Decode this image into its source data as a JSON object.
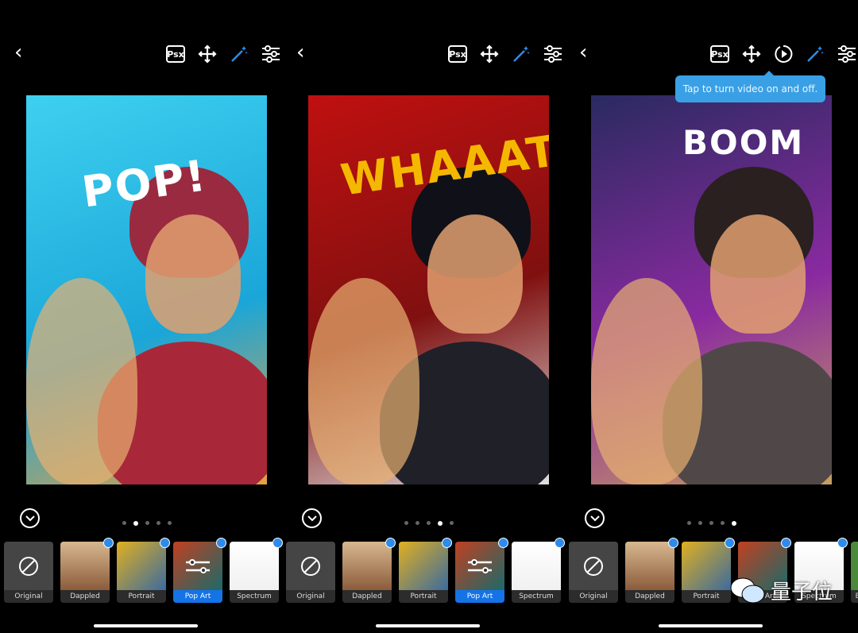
{
  "panels": [
    {
      "comic_text": "POP!",
      "bg": "linear-gradient(160deg,#3fd0f0,#1aa6d8 60%,#e8a040)",
      "shirt": "#a8283a",
      "hair": "#9a2a40",
      "active_dot": 1,
      "selected": "Pop Art",
      "comic_color": "#ffffff",
      "show_video": false
    },
    {
      "comic_text": "WHAAAT!",
      "bg": "linear-gradient(160deg,#c01010,#801010 55%,#e0e0e0)",
      "shirt": "#202028",
      "hair": "#101018",
      "active_dot": 3,
      "selected": "Pop Art",
      "comic_color": "#f5b800",
      "show_video": false
    },
    {
      "comic_text": "BOOM",
      "bg": "linear-gradient(160deg,#2a2a60,#8a2aa0 55%,#c8a060)",
      "shirt": "#504848",
      "hair": "#2a2020",
      "active_dot": 4,
      "selected": "",
      "comic_color": "#ffffff",
      "show_video": true
    }
  ],
  "toolbar": {
    "psx_label": "Psx",
    "icons": [
      "back-chevron-icon",
      "psx-icon",
      "move-icon",
      "video-play-icon",
      "magic-wand-icon",
      "sliders-icon"
    ]
  },
  "tooltip": "Tap to turn video on and off.",
  "looks": [
    {
      "label": "Original",
      "img": "#444"
    },
    {
      "label": "Dappled",
      "img": "linear-gradient(#d8b890,#8a5a3a)"
    },
    {
      "label": "Portrait",
      "img": "linear-gradient(135deg,#e0b020,#3a6aa0)"
    },
    {
      "label": "Pop Art",
      "img": "linear-gradient(135deg,#c04020,#1a6a6a)"
    },
    {
      "label": "Spectrum",
      "img": "linear-gradient(#fff,#f0f0f0)"
    }
  ],
  "partial_look": "Bi",
  "watermark": "量子位",
  "accent": "#1473e6"
}
